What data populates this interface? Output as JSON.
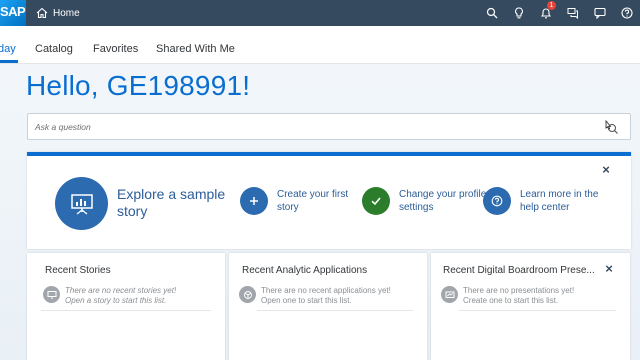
{
  "shell": {
    "logo": "SAP",
    "home_label": "Home",
    "notification_count": "1",
    "icons": [
      "search-icon",
      "lightbulb-icon",
      "bell-icon",
      "discussion-icon",
      "feedback-icon",
      "help-icon"
    ]
  },
  "tabs": [
    {
      "label": "day",
      "active": true
    },
    {
      "label": "Catalog",
      "active": false
    },
    {
      "label": "Favorites",
      "active": false
    },
    {
      "label": "Shared With Me",
      "active": false
    }
  ],
  "greeting": "Hello, GE198991!",
  "search": {
    "placeholder": "Ask a question"
  },
  "welcome": {
    "explore_label": "Explore a sample story",
    "actions": [
      {
        "label": "Create your first story",
        "color": "#2c6bb0",
        "icon": "plus-icon"
      },
      {
        "label": "Change your profile settings",
        "color": "#2b7d2b",
        "icon": "check-icon"
      },
      {
        "label": "Learn more in the help center",
        "color": "#2c6bb0",
        "icon": "question-icon"
      }
    ],
    "close": "×"
  },
  "cards": [
    {
      "title": "Recent Stories",
      "line1": "There are no recent stories yet!",
      "line2": "Open a story to start this list.",
      "italic": true
    },
    {
      "title": "Recent Analytic Applications",
      "line1": "There are no recent applications yet!",
      "line2": "Open one to start this list.",
      "italic": false
    },
    {
      "title": "Recent Digital Boardroom Prese...",
      "line1": "There are no presentations yet!",
      "line2": "Create one to start this list.",
      "italic": false,
      "close": "×"
    }
  ],
  "colors": {
    "shell": "#354a5f",
    "accent": "#0a6ed1",
    "badge": "#e9443a"
  }
}
